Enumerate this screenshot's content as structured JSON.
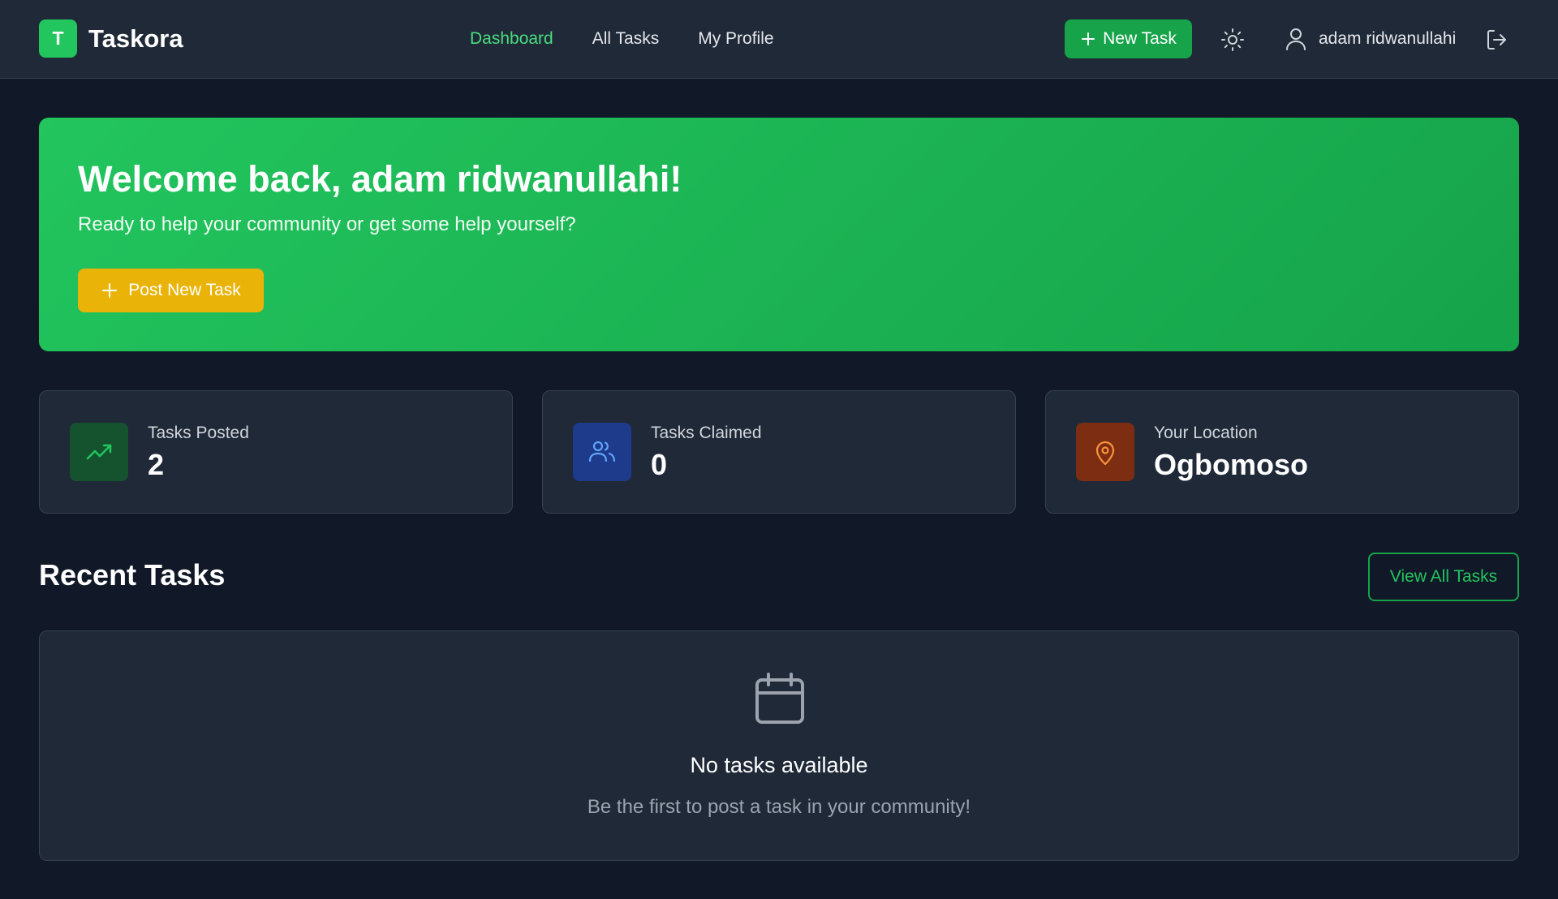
{
  "brand": {
    "logo_letter": "T",
    "name": "Taskora"
  },
  "nav": {
    "items": [
      {
        "label": "Dashboard",
        "active": true
      },
      {
        "label": "All Tasks",
        "active": false
      },
      {
        "label": "My Profile",
        "active": false
      }
    ]
  },
  "header": {
    "new_task_label": "New Task",
    "user_name": "adam ridwanullahi",
    "icons": {
      "theme": "sun-icon",
      "user": "user-icon",
      "logout": "logout-icon"
    }
  },
  "hero": {
    "title": "Welcome back, adam ridwanullahi!",
    "subtitle": "Ready to help your community or get some help yourself?",
    "button_label": "Post New Task"
  },
  "stats": [
    {
      "label": "Tasks Posted",
      "value": "2",
      "icon": "trending-up-icon",
      "color": "#14532d",
      "icon_color": "#22c55e"
    },
    {
      "label": "Tasks Claimed",
      "value": "0",
      "icon": "users-icon",
      "color": "#1e3a8a",
      "icon_color": "#60a5fa"
    },
    {
      "label": "Your Location",
      "value": "Ogbomoso",
      "icon": "map-pin-icon",
      "color": "#7c2d12",
      "icon_color": "#fb923c"
    }
  ],
  "recent": {
    "title": "Recent Tasks",
    "view_all_label": "View All Tasks",
    "empty_title": "No tasks available",
    "empty_subtitle": "Be the first to post a task in your community!",
    "empty_icon": "calendar-icon"
  },
  "colors": {
    "accent": "#22c55e",
    "background": "#111827",
    "surface": "#1f2937",
    "warning": "#eab308"
  }
}
